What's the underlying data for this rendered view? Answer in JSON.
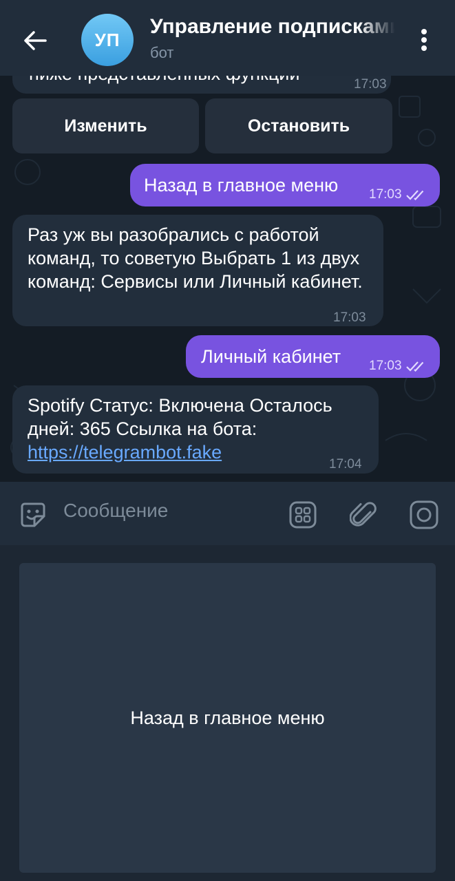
{
  "header": {
    "avatar_initials": "УП",
    "title": "Управление подписками",
    "subtitle": "бот",
    "back_icon": "arrow-left-icon",
    "menu_icon": "more-vertical-icon"
  },
  "messages": {
    "partial_text": "ниже представленных функций",
    "partial_time": "17:03",
    "inline_buttons": [
      "Изменить",
      "Остановить"
    ],
    "out1": {
      "text": "Назад в главное меню",
      "time": "17:03"
    },
    "in1": {
      "text": "Раз уж вы разобрались с работой команд, то советую Выбрать 1 из двух команд: Сервисы или Личный кабинет.",
      "time": "17:03"
    },
    "out2": {
      "text": "Личный кабинет",
      "time": "17:03"
    },
    "in2": {
      "text": "Spotify Статус: Включена Осталось дней: 365 Ссылка на бота:",
      "link": "https://telegrambot.fake",
      "time": "17:04"
    }
  },
  "input": {
    "placeholder": "Сообщение",
    "emoji_icon": "sticker-smile-icon",
    "keyboard_icon": "bot-keyboard-icon",
    "attach_icon": "paperclip-icon",
    "camera_icon": "camera-icon"
  },
  "reply_keyboard": {
    "button_label": "Назад в главное меню"
  },
  "colors": {
    "header_bg": "#212d3b",
    "chat_bg": "#141c25",
    "incoming_bubble": "#222e3c",
    "outgoing_bubble": "#7853e0",
    "link": "#69a9ff"
  }
}
